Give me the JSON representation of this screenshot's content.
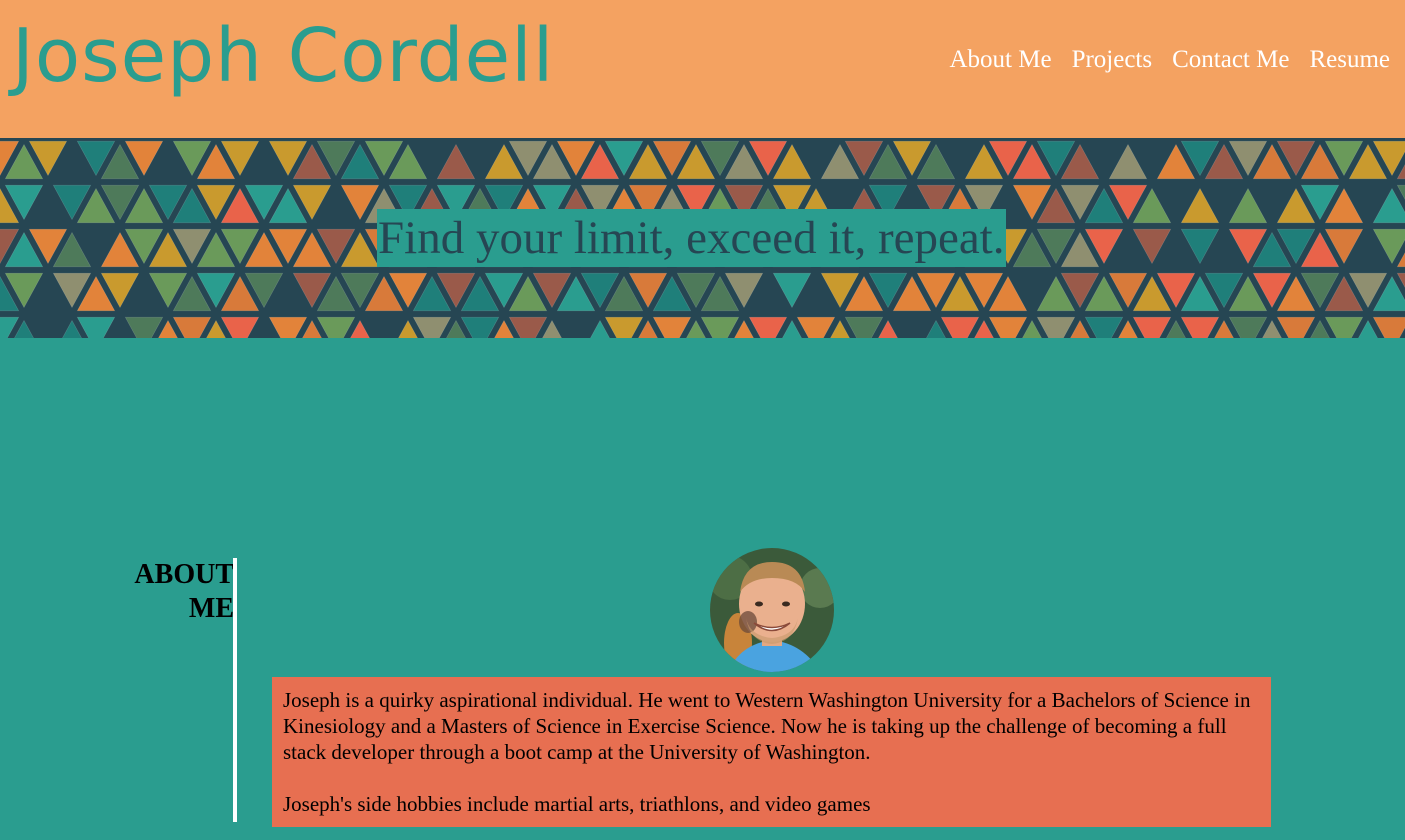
{
  "header": {
    "title": "Joseph Cordell",
    "nav": [
      "About Me",
      "Projects",
      "Contact Me",
      "Resume"
    ]
  },
  "hero": {
    "tagline": "Find your limit, exceed it, repeat."
  },
  "about": {
    "heading_line1": "ABOUT",
    "heading_line2": "ME",
    "paragraph1": "Joseph is a quirky aspirational individual. He went to Western Washington University for a Bachelors of Science in Kinesiology and a Masters of Science in Exercise Science. Now he is taking up the challenge of becoming a full stack developer through a boot camp at the University of Washington.",
    "paragraph2": "Joseph's side hobbies include martial arts, triathlons, and video games"
  },
  "colors": {
    "header_bg": "#f4a261",
    "title": "#2a9d8f",
    "page_bg": "#2a9d8f",
    "about_box": "#e76f51",
    "hero_grid": "#264653"
  }
}
